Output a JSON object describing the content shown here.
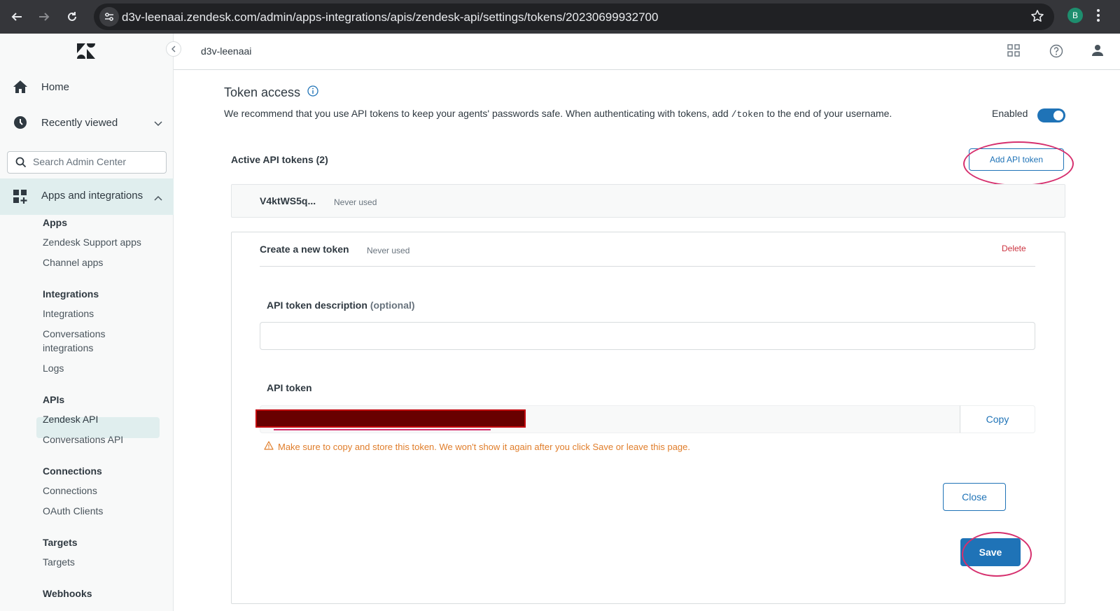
{
  "browser": {
    "url": "d3v-leenaai.zendesk.com/admin/apps-integrations/apis/zendesk-api/settings/tokens/20230699932700",
    "profile_initial": "B"
  },
  "sidebar": {
    "home_label": "Home",
    "recent_label": "Recently viewed",
    "search_placeholder": "Search Admin Center",
    "apps_integrations_label": "Apps and integrations",
    "sections": [
      {
        "heading": "Apps",
        "items": [
          "Zendesk Support apps",
          "Channel apps"
        ]
      },
      {
        "heading": "Integrations",
        "items": [
          "Integrations",
          "Conversations integrations",
          "Logs"
        ]
      },
      {
        "heading": "APIs",
        "items": [
          "Zendesk API",
          "Conversations API"
        ]
      },
      {
        "heading": "Connections",
        "items": [
          "Connections",
          "OAuth Clients"
        ]
      },
      {
        "heading": "Targets",
        "items": [
          "Targets"
        ]
      },
      {
        "heading": "Webhooks",
        "items": []
      }
    ],
    "conv_integrations_line1": "Conversations",
    "conv_integrations_line2": "integrations"
  },
  "topbar": {
    "account_name": "d3v-leenaai"
  },
  "main": {
    "title": "Token access",
    "description_prefix": "We recommend that you use API tokens to keep your agents' passwords safe. When authenticating with tokens, add",
    "description_code": "/token",
    "description_suffix": "to the end of your username.",
    "enabled_label": "Enabled",
    "active_tokens_heading": "Active API tokens (2)",
    "add_token_label": "Add API token",
    "existing_token": {
      "name": "V4ktWS5q...",
      "status": "Never used"
    },
    "new_token": {
      "heading": "Create a new token",
      "status": "Never used",
      "delete_label": "Delete",
      "description_label": "API token description",
      "description_optional": "(optional)",
      "description_value": "",
      "token_label": "API token",
      "copy_label": "Copy",
      "warning": "Make sure to copy and store this token. We won't show it again after you click Save or leave this page.",
      "close_label": "Close",
      "save_label": "Save"
    }
  },
  "colors": {
    "accent": "#1f73b7",
    "danger": "#cc3340",
    "warning": "#e07d2a",
    "annotation": "#d6306e",
    "redaction": "#680000"
  }
}
